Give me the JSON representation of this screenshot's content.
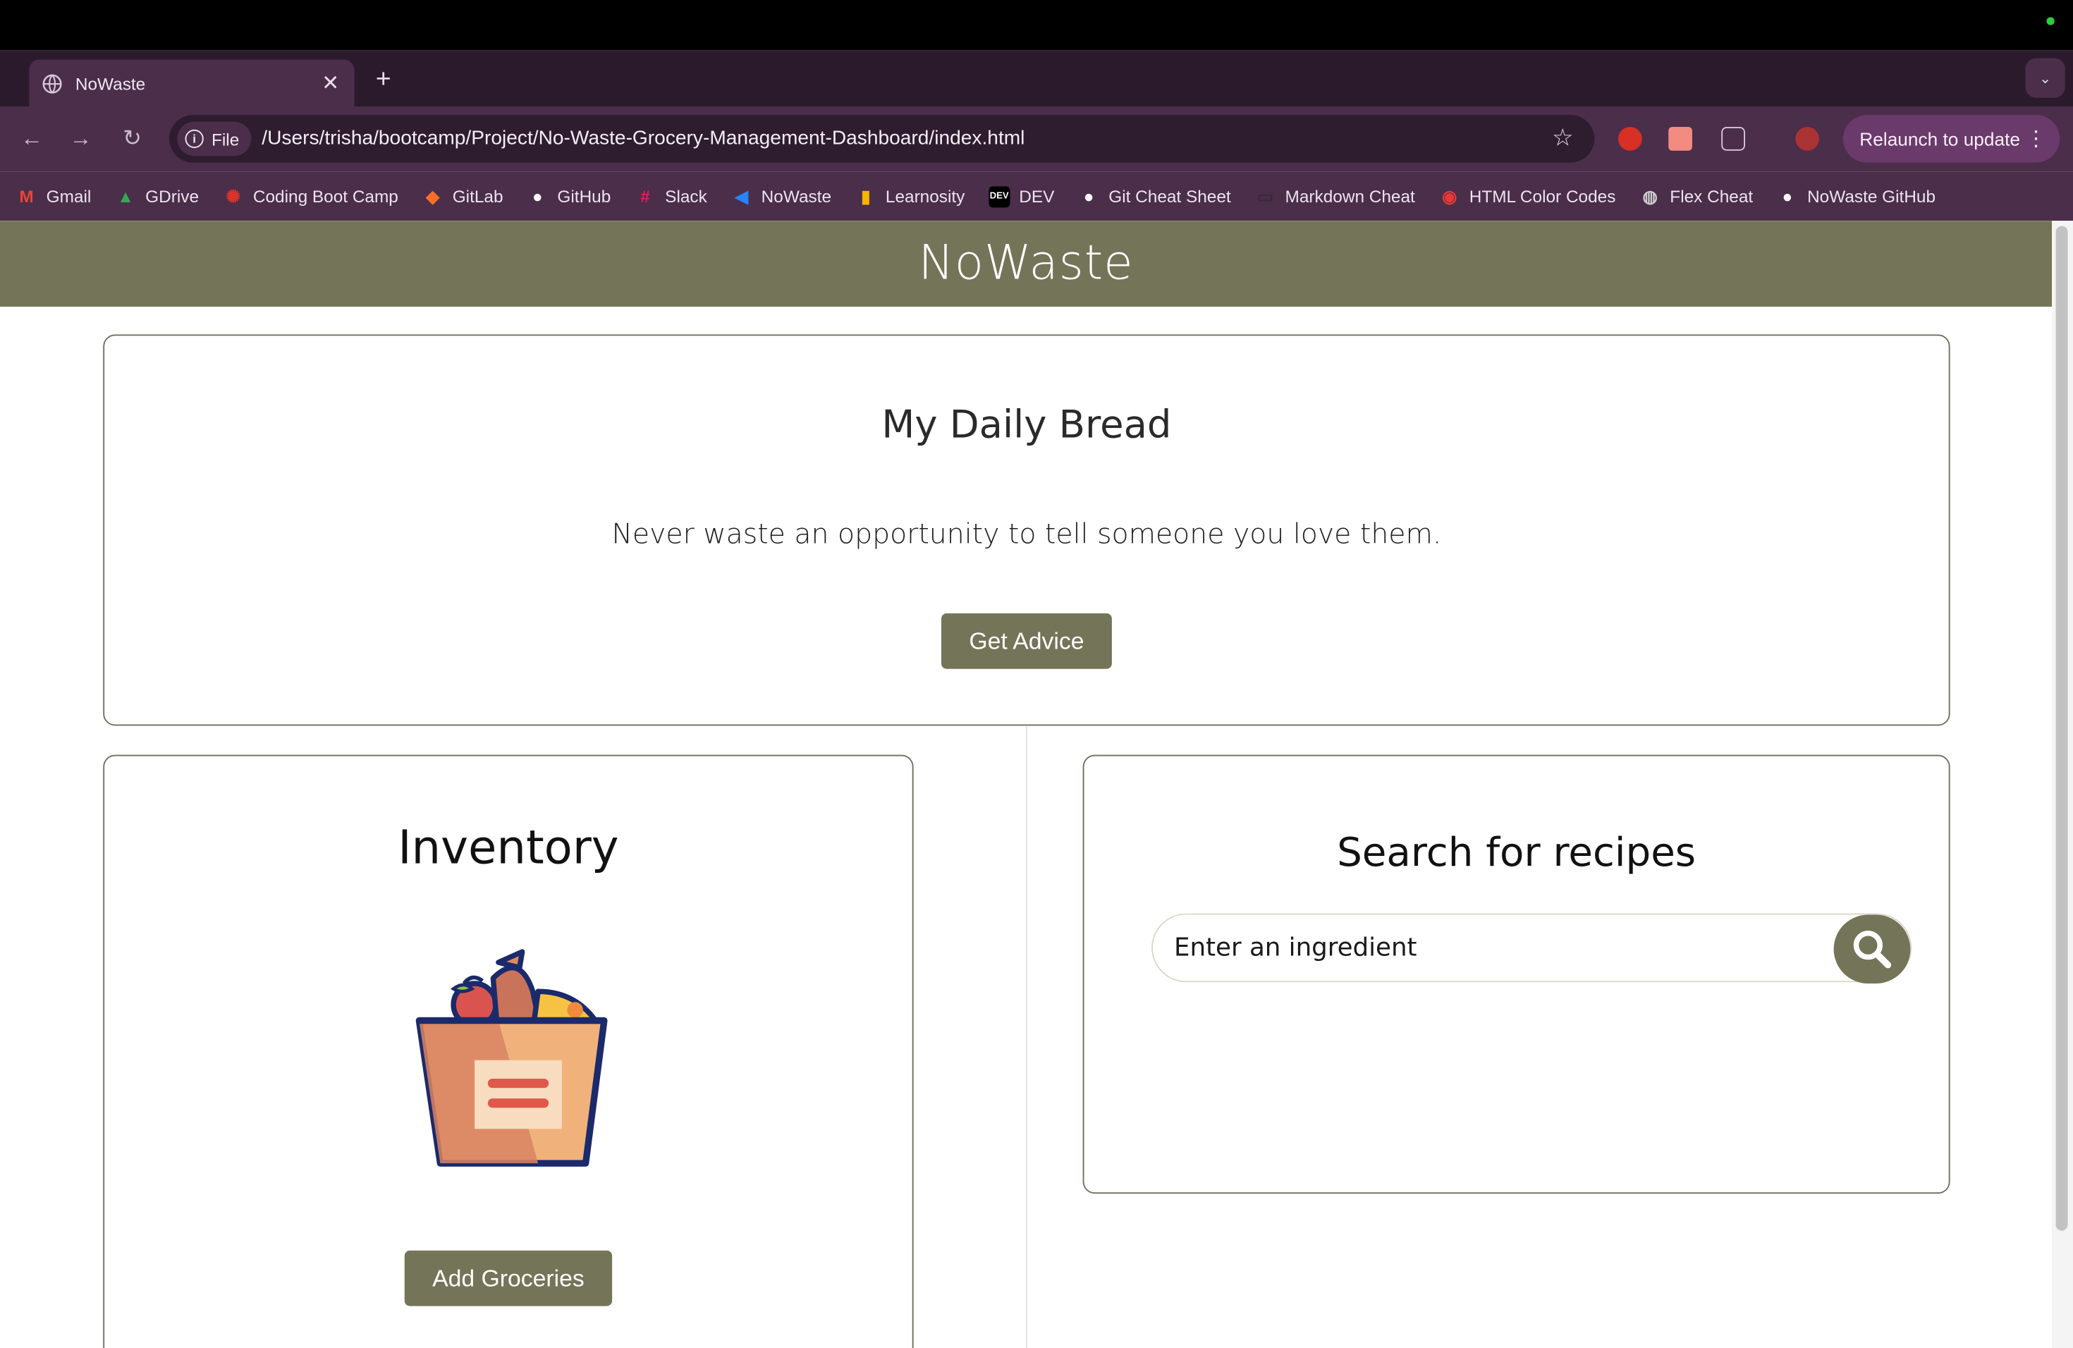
{
  "browser": {
    "tab": {
      "title": "NoWaste"
    },
    "address_chip": "File",
    "url": "/Users/trisha/bootcamp/Project/No-Waste-Grocery-Management-Dashboard/index.html",
    "relaunch_label": "Relaunch to update",
    "bookmarks": [
      {
        "label": "Gmail",
        "icon": "gmail-icon",
        "color": "#ea4335"
      },
      {
        "label": "GDrive",
        "icon": "gdrive-icon",
        "color": "#34a853"
      },
      {
        "label": "Coding Boot Camp",
        "icon": "bootcamp-icon",
        "color": "#d9342b"
      },
      {
        "label": "GitLab",
        "icon": "gitlab-icon",
        "color": "#fc6d26"
      },
      {
        "label": "GitHub",
        "icon": "github-icon",
        "color": "#ffffff"
      },
      {
        "label": "Slack",
        "icon": "slack-icon",
        "color": "#e01e5a"
      },
      {
        "label": "NoWaste",
        "icon": "jira-icon",
        "color": "#2684ff"
      },
      {
        "label": "Learnosity",
        "icon": "learnosity-icon",
        "color": "#f4b400"
      },
      {
        "label": "DEV",
        "icon": "dev-icon",
        "color": "#000000"
      },
      {
        "label": "Git Cheat Sheet",
        "icon": "github-icon",
        "color": "#ffffff"
      },
      {
        "label": "Markdown Cheat",
        "icon": "markdown-icon",
        "color": "#3a2a3a"
      },
      {
        "label": "HTML Color Codes",
        "icon": "htmlcolor-icon",
        "color": "#e53935"
      },
      {
        "label": "Flex Cheat",
        "icon": "globe-icon",
        "color": "#cccccc"
      },
      {
        "label": "NoWaste GitHub",
        "icon": "github-icon",
        "color": "#ffffff"
      }
    ]
  },
  "site": {
    "title": "NoWaste",
    "daily": {
      "title": "My Daily Bread",
      "quote": "Never waste an opportunity to tell someone you love them.",
      "button": "Get Advice"
    },
    "inventory": {
      "title": "Inventory",
      "button": "Add Groceries"
    },
    "recipes": {
      "title": "Search for recipes",
      "placeholder": "Enter an ingredient"
    }
  },
  "colors": {
    "accent": "#747458",
    "browser_frame": "#4a2e4a"
  }
}
